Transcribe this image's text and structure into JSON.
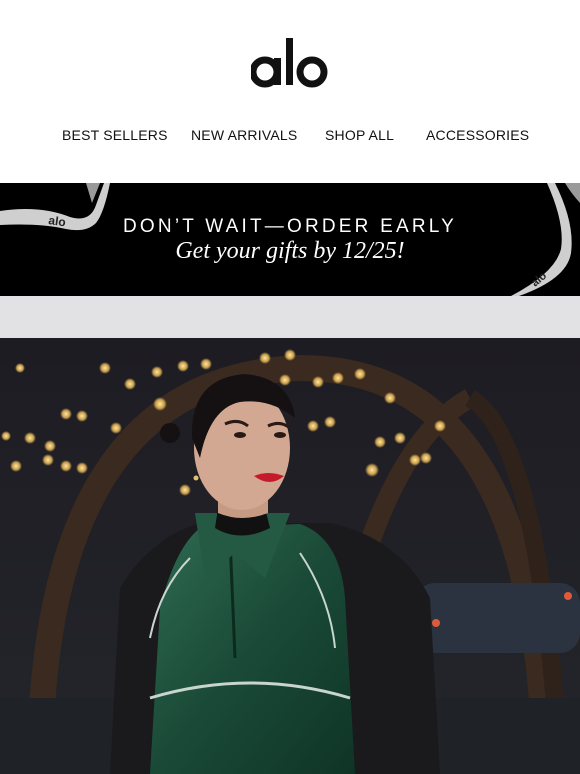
{
  "brand": {
    "logo_text": "alo"
  },
  "nav": {
    "items": [
      {
        "label": "BEST SELLERS"
      },
      {
        "label": "NEW ARRIVALS"
      },
      {
        "label": "SHOP ALL"
      },
      {
        "label": "ACCESSORIES"
      }
    ]
  },
  "banner": {
    "headline": "DON’T WAIT—ORDER EARLY",
    "subheadline": "Get your gifts by 12/25!",
    "ribbon_text": "alo",
    "colors": {
      "background": "#000000",
      "text": "#ffffff",
      "ribbon": "#c9c9c9"
    }
  },
  "hero": {
    "description_icon": "model-in-green-satin-jacket-photo"
  }
}
